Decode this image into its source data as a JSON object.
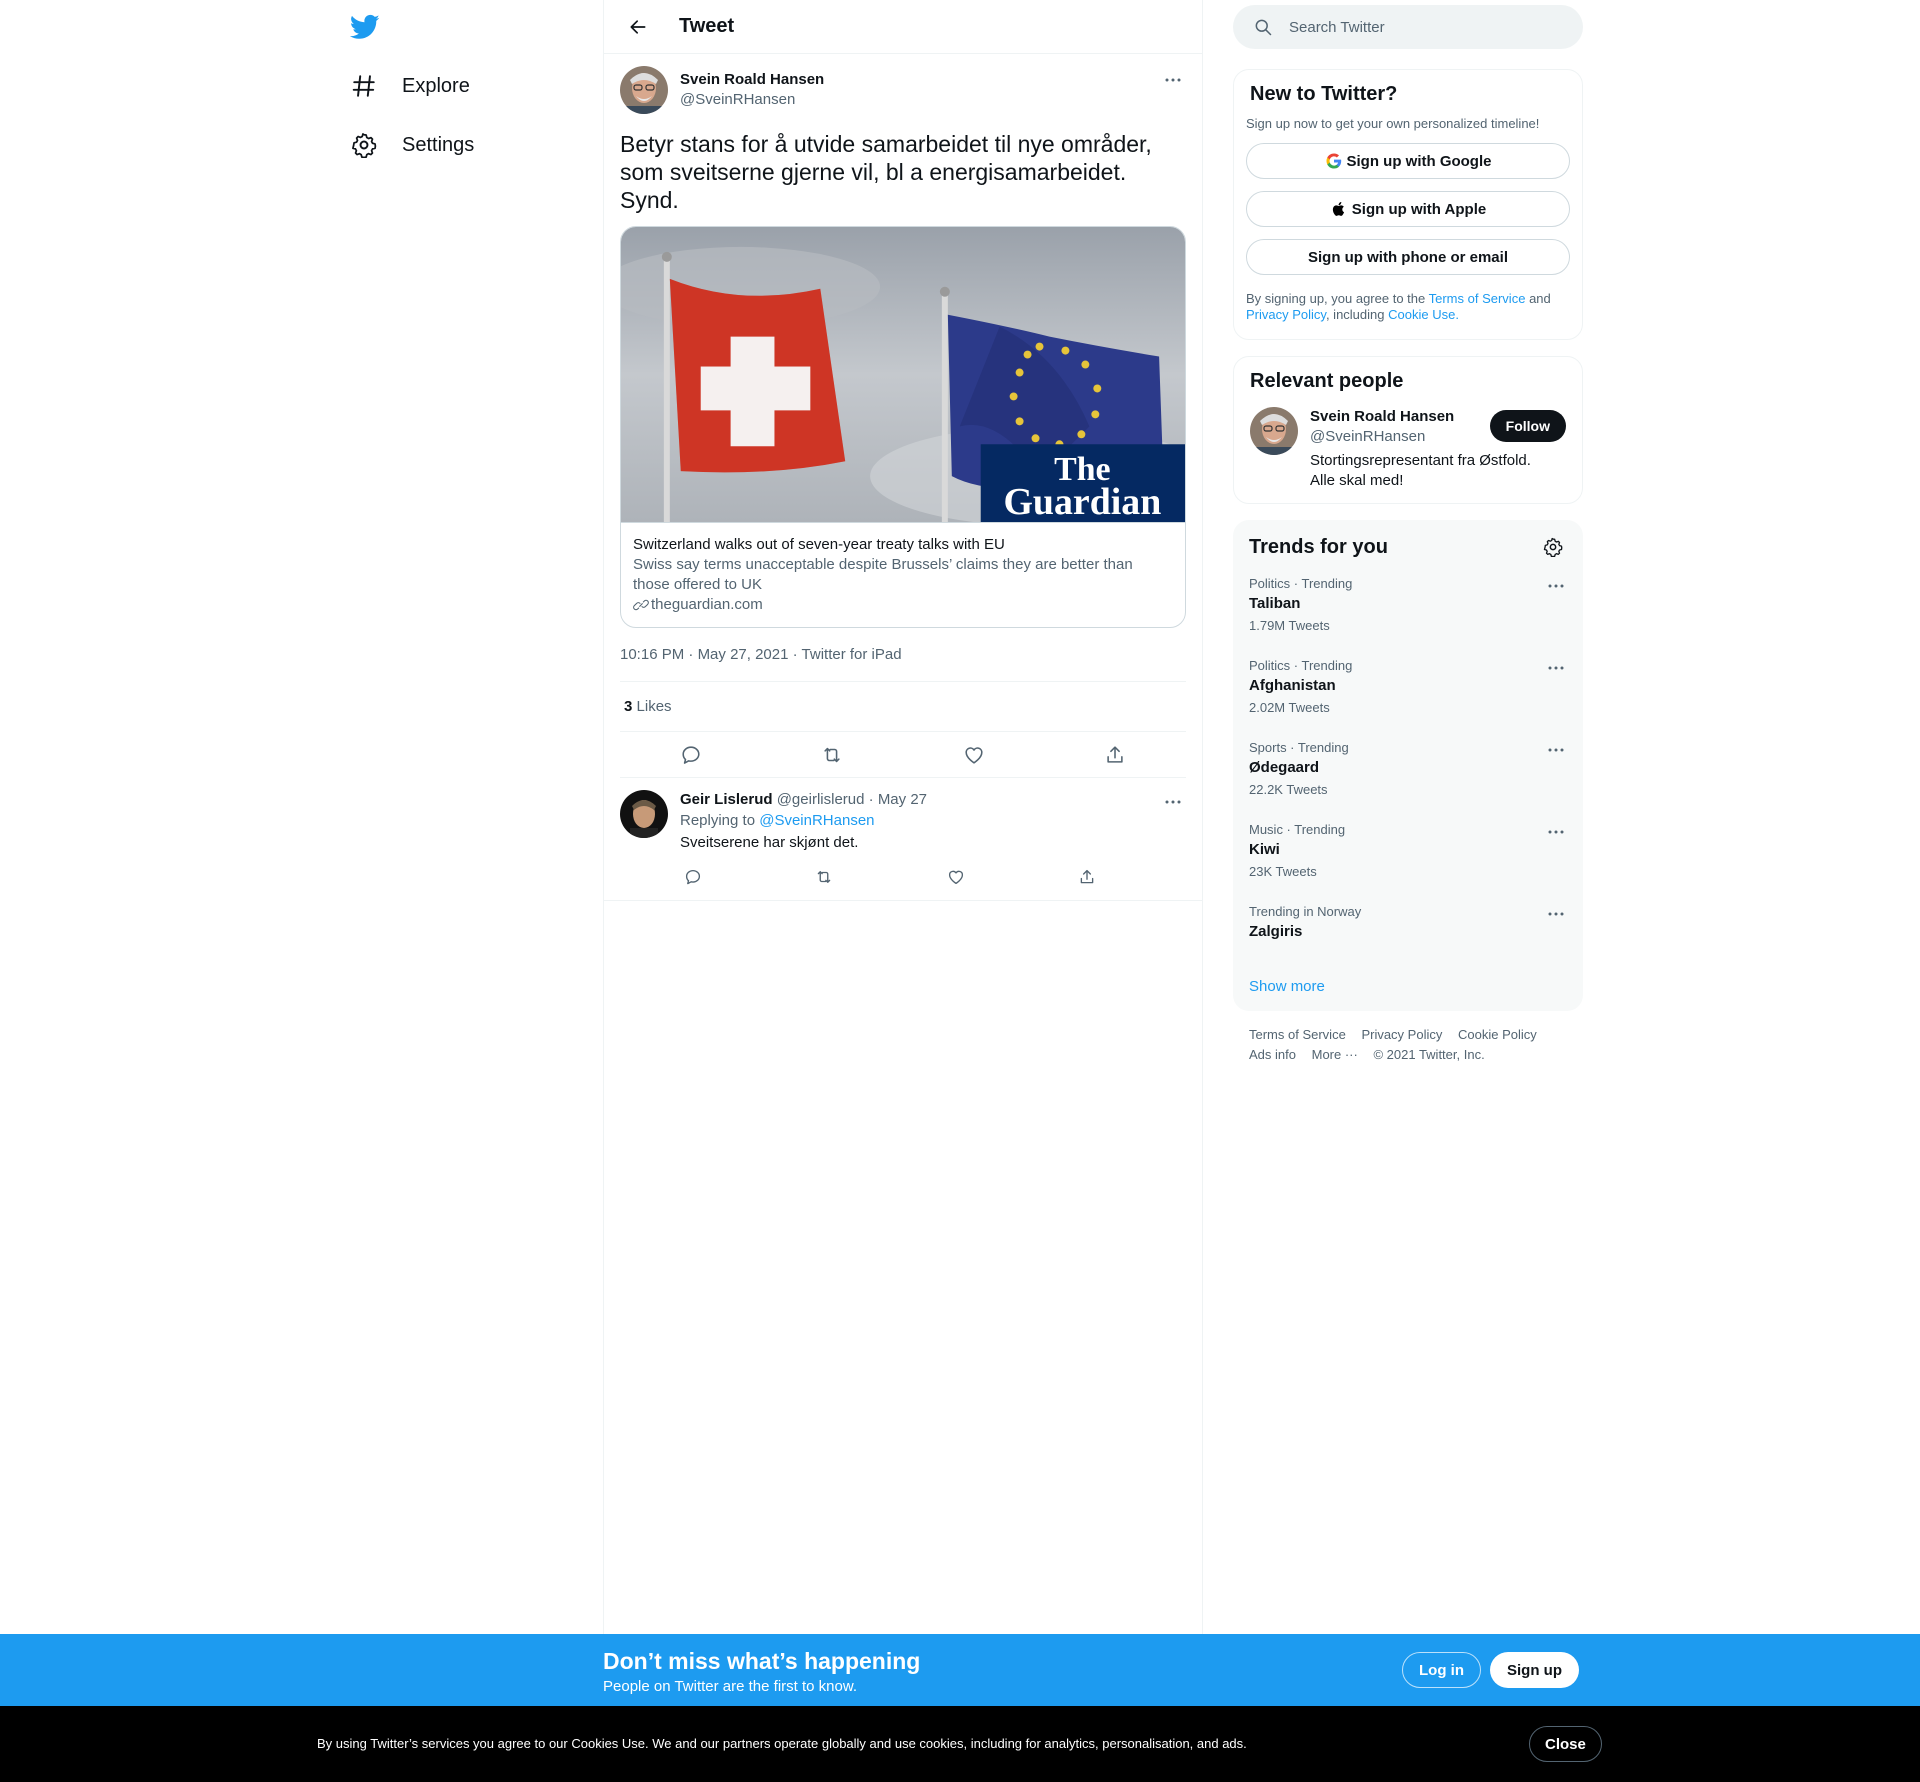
{
  "nav": {
    "logo": "twitter-bird",
    "items": [
      {
        "label": "Explore",
        "icon": "hashtag-icon"
      },
      {
        "label": "Settings",
        "icon": "gear-icon"
      }
    ]
  },
  "main": {
    "title": "Tweet",
    "tweet": {
      "name": "Svein Roald Hansen",
      "handle": "@SveinRHansen",
      "text": "Betyr stans for å utvide samarbeidet til nye områder, som sveitserne gjerne vil, bl a energisamarbeidet. Synd.",
      "card": {
        "logo_line1": "The",
        "logo_line2": "Guardian",
        "title": "Switzerland walks out of seven-year treaty talks with EU",
        "description": "Swiss say terms unacceptable despite Brussels’ claims they are better than those offered to UK",
        "domain": "theguardian.com"
      },
      "time": "10:16 PM",
      "date": "May 27, 2021",
      "source": "Twitter for iPad",
      "likes_count": "3",
      "likes_label": "Likes"
    },
    "reply": {
      "name": "Geir Lislerud",
      "handle": "@geirlislerud",
      "date": "May 27",
      "replying_prefix": "Replying to",
      "replying_to": "@SveinRHansen",
      "text": "Sveitserene har skjønt det."
    }
  },
  "sidebar": {
    "search_placeholder": "Search Twitter",
    "new_to_twitter": {
      "title": "New to Twitter?",
      "subtitle": "Sign up now to get your own personalized timeline!",
      "google": "Sign up with Google",
      "apple": "Sign up with Apple",
      "phone": "Sign up with phone or email",
      "legal_1": "By signing up, you agree to the",
      "tos": "Terms of Service",
      "legal_and": "and",
      "privacy": "Privacy Policy",
      "legal_including": ", including",
      "cookie": "Cookie Use."
    },
    "relevant": {
      "title": "Relevant people",
      "name": "Svein Roald Hansen",
      "handle": "@SveinRHansen",
      "bio": "Stortingsrepresentant fra Østfold. Alle skal med!",
      "follow": "Follow"
    },
    "trends": {
      "title": "Trends for you",
      "items": [
        {
          "context": "Politics · Trending",
          "name": "Taliban",
          "count": "1.79M Tweets"
        },
        {
          "context": "Politics · Trending",
          "name": "Afghanistan",
          "count": "2.02M Tweets"
        },
        {
          "context": "Sports · Trending",
          "name": "Ødegaard",
          "count": "22.2K Tweets"
        },
        {
          "context": "Music · Trending",
          "name": "Kiwi",
          "count": "23K Tweets"
        },
        {
          "context": "Trending in Norway",
          "name": "Zalgiris",
          "count": ""
        }
      ],
      "show_more": "Show more"
    },
    "footer": {
      "terms": "Terms of Service",
      "privacy": "Privacy Policy",
      "cookie": "Cookie Policy",
      "ads": "Ads info",
      "more": "More ···",
      "copyright": "© 2021 Twitter, Inc."
    }
  },
  "signup_bar": {
    "title": "Don’t miss what’s happening",
    "subtitle": "People on Twitter are the first to know.",
    "login": "Log in",
    "signup": "Sign up"
  },
  "cookie_bar": {
    "text": "By using Twitter’s services you agree to our Cookies Use. We and our partners operate globally and use cookies, including for analytics, personalisation, and ads.",
    "close": "Close"
  },
  "colors": {
    "accent": "#1d9bf0",
    "text": "#0f1419",
    "secondary": "#536471",
    "cookie_bg": "#000000"
  }
}
